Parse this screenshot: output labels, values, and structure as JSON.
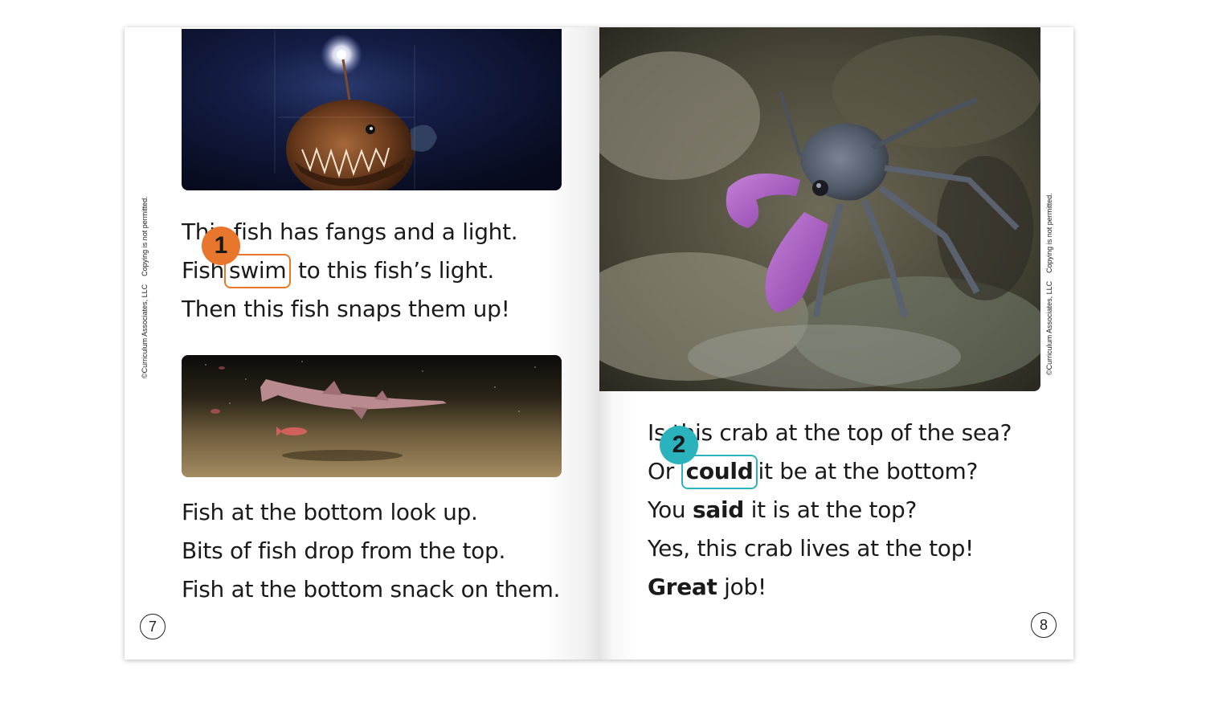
{
  "copyright": {
    "owner": "©Curriculum Associates, LLC",
    "notice": "Copying is not permitted."
  },
  "left_page": {
    "paragraph_1": {
      "line_1": "This fish has fangs and a light.",
      "line_2_before": "Fish",
      "line_2_word": "swim",
      "line_2_after": "to this fish’s light.",
      "line_3": "Then this fish snaps them up!"
    },
    "paragraph_2": {
      "line_1": "Fish at the bottom look up.",
      "line_2": "Bits of fish drop from the top.",
      "line_3": "Fish at the bottom snack on them."
    },
    "badge": "1",
    "page_number": "7"
  },
  "right_page": {
    "paragraph": {
      "line_1": "Is this crab at the top of the sea?",
      "line_2_before": "Or",
      "line_2_word": "could",
      "line_2_after": "it be at the bottom?",
      "line_3_before": "You",
      "line_3_word": "said",
      "line_3_after": "it is at the top?",
      "line_4": "Yes, this crab lives at the top!",
      "line_5_word": "Great",
      "line_5_after": "job!"
    },
    "badge": "2",
    "page_number": "8"
  },
  "colors": {
    "orange_accent": "#e8762c",
    "teal_accent": "#2bb3bd",
    "text": "#1a1a1a"
  },
  "images": {
    "anglerfish": "anglerfish-photo",
    "shark": "deep-sea-shark-photo",
    "crab": "purple-claw-crab-photo"
  }
}
